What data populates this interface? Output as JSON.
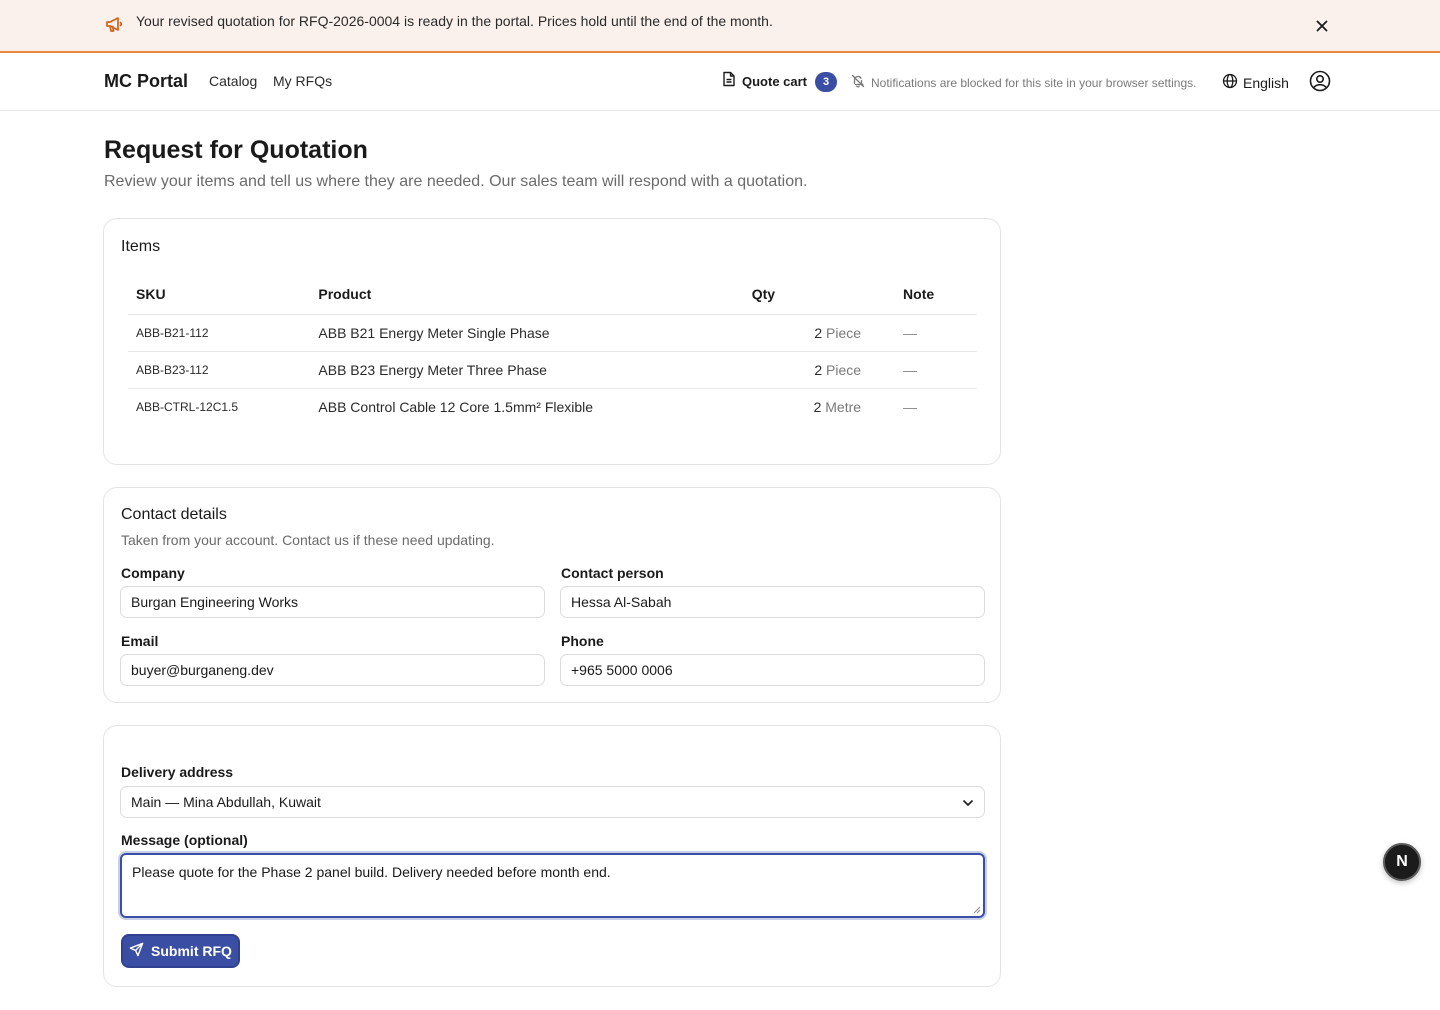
{
  "announcement": {
    "text": "Your revised quotation for RFQ-2026-0004 is ready in the portal. Prices hold until the end of the month.",
    "icon": "megaphone-icon",
    "close_icon": "close-icon"
  },
  "header": {
    "brand": "MC Portal",
    "nav": [
      "Catalog",
      "My RFQs"
    ],
    "quote_cart": {
      "label": "Quote cart",
      "count": "3"
    },
    "notifications_text": "Notifications are blocked for this site in your browser settings.",
    "language": "English"
  },
  "page": {
    "title": "Request for Quotation",
    "subtitle": "Review your items and tell us where they are needed. Our sales team will respond with a quotation."
  },
  "items": {
    "heading": "Items",
    "columns": [
      "SKU",
      "Product",
      "Qty",
      "Note"
    ],
    "rows": [
      {
        "sku": "ABB-B21-112",
        "product": "ABB B21 Energy Meter Single Phase",
        "qty": "2",
        "unit": "Piece",
        "note": "—"
      },
      {
        "sku": "ABB-B23-112",
        "product": "ABB B23 Energy Meter Three Phase",
        "qty": "2",
        "unit": "Piece",
        "note": "—"
      },
      {
        "sku": "ABB-CTRL-12C1.5",
        "product": "ABB Control Cable 12 Core 1.5mm² Flexible",
        "qty": "2",
        "unit": "Metre",
        "note": "—"
      }
    ]
  },
  "contact": {
    "heading": "Contact details",
    "subtitle": "Taken from your account. Contact us if these need updating.",
    "company_label": "Company",
    "company_value": "Burgan Engineering Works",
    "person_label": "Contact person",
    "person_value": "Hessa Al-Sabah",
    "email_label": "Email",
    "email_value": "buyer@burganeng.dev",
    "phone_label": "Phone",
    "phone_value": "+965 5000 0006"
  },
  "delivery": {
    "address_label": "Delivery address",
    "address_value": "Main — Mina Abdullah, Kuwait",
    "message_label": "Message (optional)",
    "message_value": "Please quote for the Phase 2 panel build. Delivery needed before month end.",
    "submit_label": "Submit RFQ"
  },
  "fab": {
    "letter": "N"
  },
  "colors": {
    "accent": "#3a4fa3",
    "banner_bg": "#fbf1ec",
    "banner_border": "#e8893e",
    "megaphone": "#d2621e"
  }
}
